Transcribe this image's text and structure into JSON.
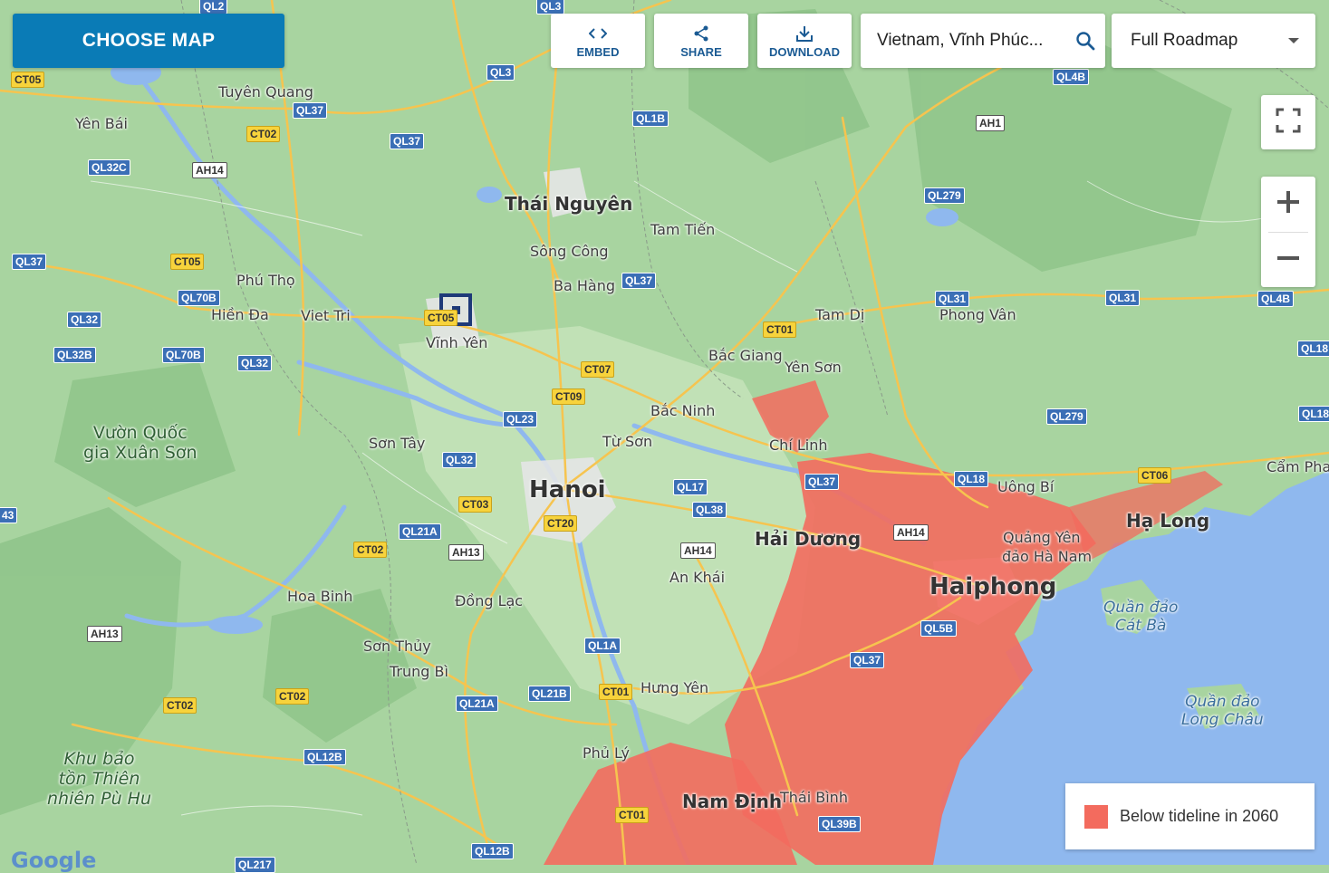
{
  "toolbar": {
    "choose_map_label": "CHOOSE MAP",
    "embed_label": "EMBED",
    "share_label": "SHARE",
    "download_label": "DOWNLOAD",
    "search_value": "Vietnam, Vĩnh Phúc...",
    "map_type_value": "Full Roadmap"
  },
  "icons": {
    "embed": "code-icon",
    "share": "share-icon",
    "download": "download-icon",
    "search": "search-icon",
    "fullscreen": "fullscreen-icon",
    "zoom_in": "plus-icon",
    "zoom_out": "minus-icon"
  },
  "legend": {
    "label": "Below tideline in 2060",
    "color": "#f36b5e"
  },
  "colors": {
    "land": "#a8d4a0",
    "water": "#8fb8ee",
    "flood": "#f36b5e",
    "road_major": "#f6c44f",
    "brand": "#0a7bb6"
  },
  "places": {
    "hanoi": "Hanoi",
    "haiphong": "Haiphong",
    "thai_nguyen": "Thái Nguyên",
    "hai_duong": "Hải Dương",
    "nam_dinh": "Nam Định",
    "ha_long": "Hạ Long",
    "tuyen_quang": "Tuyên Quang",
    "yen_bai": "Yên Bái",
    "phu_tho": "Phú Thọ",
    "hien_da": "Hiền Đa",
    "viet_tri": "Viet Tri",
    "vinh_yen": "Vĩnh Yên",
    "song_cong": "Sông Công",
    "ba_hang": "Ba Hàng",
    "tam_tien": "Tam Tiến",
    "tam_di": "Tam Dị",
    "phong_van": "Phong Vân",
    "bac_giang": "Bắc Giang",
    "yen_son": "Yên Sơn",
    "bac_ninh": "Bắc Ninh",
    "tu_son": "Từ Sơn",
    "son_tay": "Sơn Tây",
    "chi_linh": "Chí Linh",
    "uong_bi": "Uông Bí",
    "cam_pha": "Cẩm Pha",
    "quang_yen": "Quảng Yên",
    "dao_ha_nam": "đảo Hà Nam",
    "an_khai": "An Khái",
    "hoa_binh": "Hoa Binh",
    "dong_lac": "Đồng Lạc",
    "son_thuy": "Sơn Thủy",
    "trung_bi": "Trung Bì",
    "hung_yen": "Hưng Yên",
    "phu_ly": "Phủ Lý",
    "thai_binh": "Thái Bình",
    "vuon_quoc_gia_1": "Vườn Quốc",
    "vuon_quoc_gia_2": "gia Xuân Sơn",
    "khu_bao_ton_1": "Khu bảo",
    "khu_bao_ton_2": "tồn Thiên",
    "khu_bao_ton_3": "nhiên Pù Hu",
    "cat_ba_1": "Quần đảo",
    "cat_ba_2": "Cát Bà",
    "long_chau_1": "Quần đảo",
    "long_chau_2": "Long Châu"
  },
  "roads": {
    "ql2": "QL2",
    "ql3": "QL3",
    "ql3b": "QL3",
    "ct05a": "CT05",
    "ql37a": "QL37",
    "ct02a": "CT02",
    "ql37b": "QL37",
    "ql32c": "QL32C",
    "ah14a": "AH14",
    "ql1b": "QL1B",
    "ql4b": "QL4B",
    "ah1": "AH1",
    "ql279a": "QL279",
    "ql37c": "QL37",
    "ct05b": "CT05",
    "ql70b": "QL70B",
    "ql32": "QL32",
    "ql32b": "QL32B",
    "ql70b2": "QL70B",
    "ql32d": "QL32",
    "ct05c": "CT05",
    "ql37d": "QL37",
    "ct01a": "CT01",
    "ql31a": "QL31",
    "ql31b": "QL31",
    "ql4b2": "QL4B",
    "ql18a": "QL18",
    "ct07": "CT07",
    "ct09": "CT09",
    "ql23": "QL23",
    "ql279b": "QL279",
    "ql18b": "QL18",
    "ql32e": "QL32",
    "ql37e": "QL37",
    "ql17": "QL17",
    "ql38": "QL38",
    "ql18c": "QL18",
    "ct06": "CT06",
    "ct03": "CT03",
    "ct20": "CT20",
    "ql21a": "QL21A",
    "ah13a": "AH13",
    "ct02b": "CT02",
    "ah14b": "AH14",
    "ah14c": "AH14",
    "ql5b": "QL5B",
    "ah13b": "AH13",
    "ql1a": "QL1A",
    "ql37f": "QL37",
    "ql21b": "QL21B",
    "ct01b": "CT01",
    "ql21a2": "QL21A",
    "ct02c": "CT02",
    "ct02d": "CT02",
    "ql12b": "QL12B",
    "ct01c": "CT01",
    "ql39b": "QL39B",
    "ql12b2": "QL12B",
    "ql43": "43",
    "ql217": "QL217"
  },
  "google_mark": "Google"
}
